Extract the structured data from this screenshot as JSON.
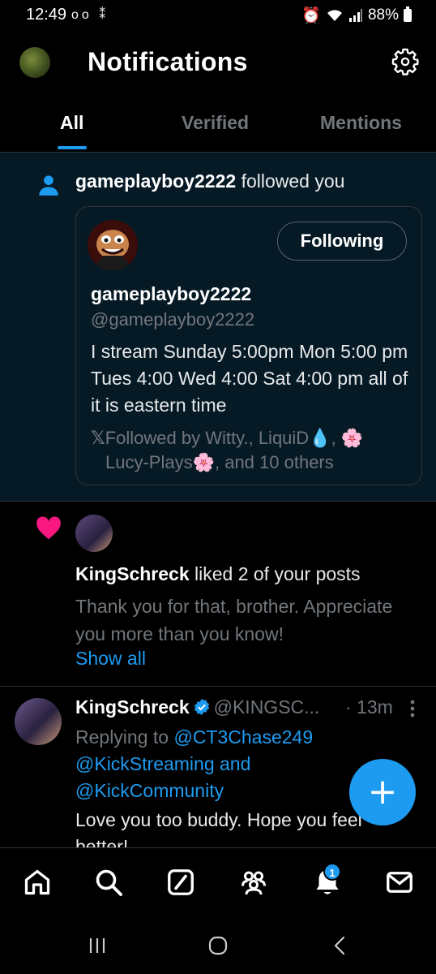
{
  "status_bar": {
    "time": "12:49",
    "left_icons": "oo ⁑",
    "battery_percent": "88%"
  },
  "header": {
    "title": "Notifications"
  },
  "tabs": [
    {
      "label": "All",
      "active": true
    },
    {
      "label": "Verified",
      "active": false
    },
    {
      "label": "Mentions",
      "active": false
    }
  ],
  "follow_notification": {
    "username": "gameplayboy2222",
    "action": "followed you",
    "card": {
      "button_label": "Following",
      "name": "gameplayboy2222",
      "handle": "@gameplayboy2222",
      "bio": "I stream Sunday 5:00pm Mon 5:00 pm Tues 4:00 Wed 4:00 Sat 4:00 pm all of it is eastern time",
      "followed_by_line1": "Followed by Witty., LiquiD💧, 🌸",
      "followed_by_line2": "Lucy-Plays🌸, and 10 others"
    }
  },
  "like_notification": {
    "username": "KingSchreck",
    "action": "liked 2 of your posts",
    "preview": "Thank you for that, brother. Appreciate you more than you know!",
    "show_all_label": "Show all"
  },
  "reply_tweet": {
    "name": "KingSchreck",
    "handle": "@KINGSC...",
    "time": "· 13m",
    "replying_prefix": "Replying to",
    "reply_to_1": "@CT3Chase249",
    "reply_to_2": "@KickStreaming",
    "reply_and": "and",
    "reply_to_3": "@KickCommunity",
    "body": "Love you too buddy. Hope you feel better!"
  },
  "fab_label": "+",
  "bottom_nav": {
    "notification_badge": "1",
    "items": [
      "home-icon",
      "search-icon",
      "grok-icon",
      "communities-icon",
      "notifications-icon",
      "messages-icon"
    ]
  },
  "colors": {
    "accent": "#1d9bf0",
    "like": "#f91880",
    "highlight_bg": "#061a26"
  }
}
